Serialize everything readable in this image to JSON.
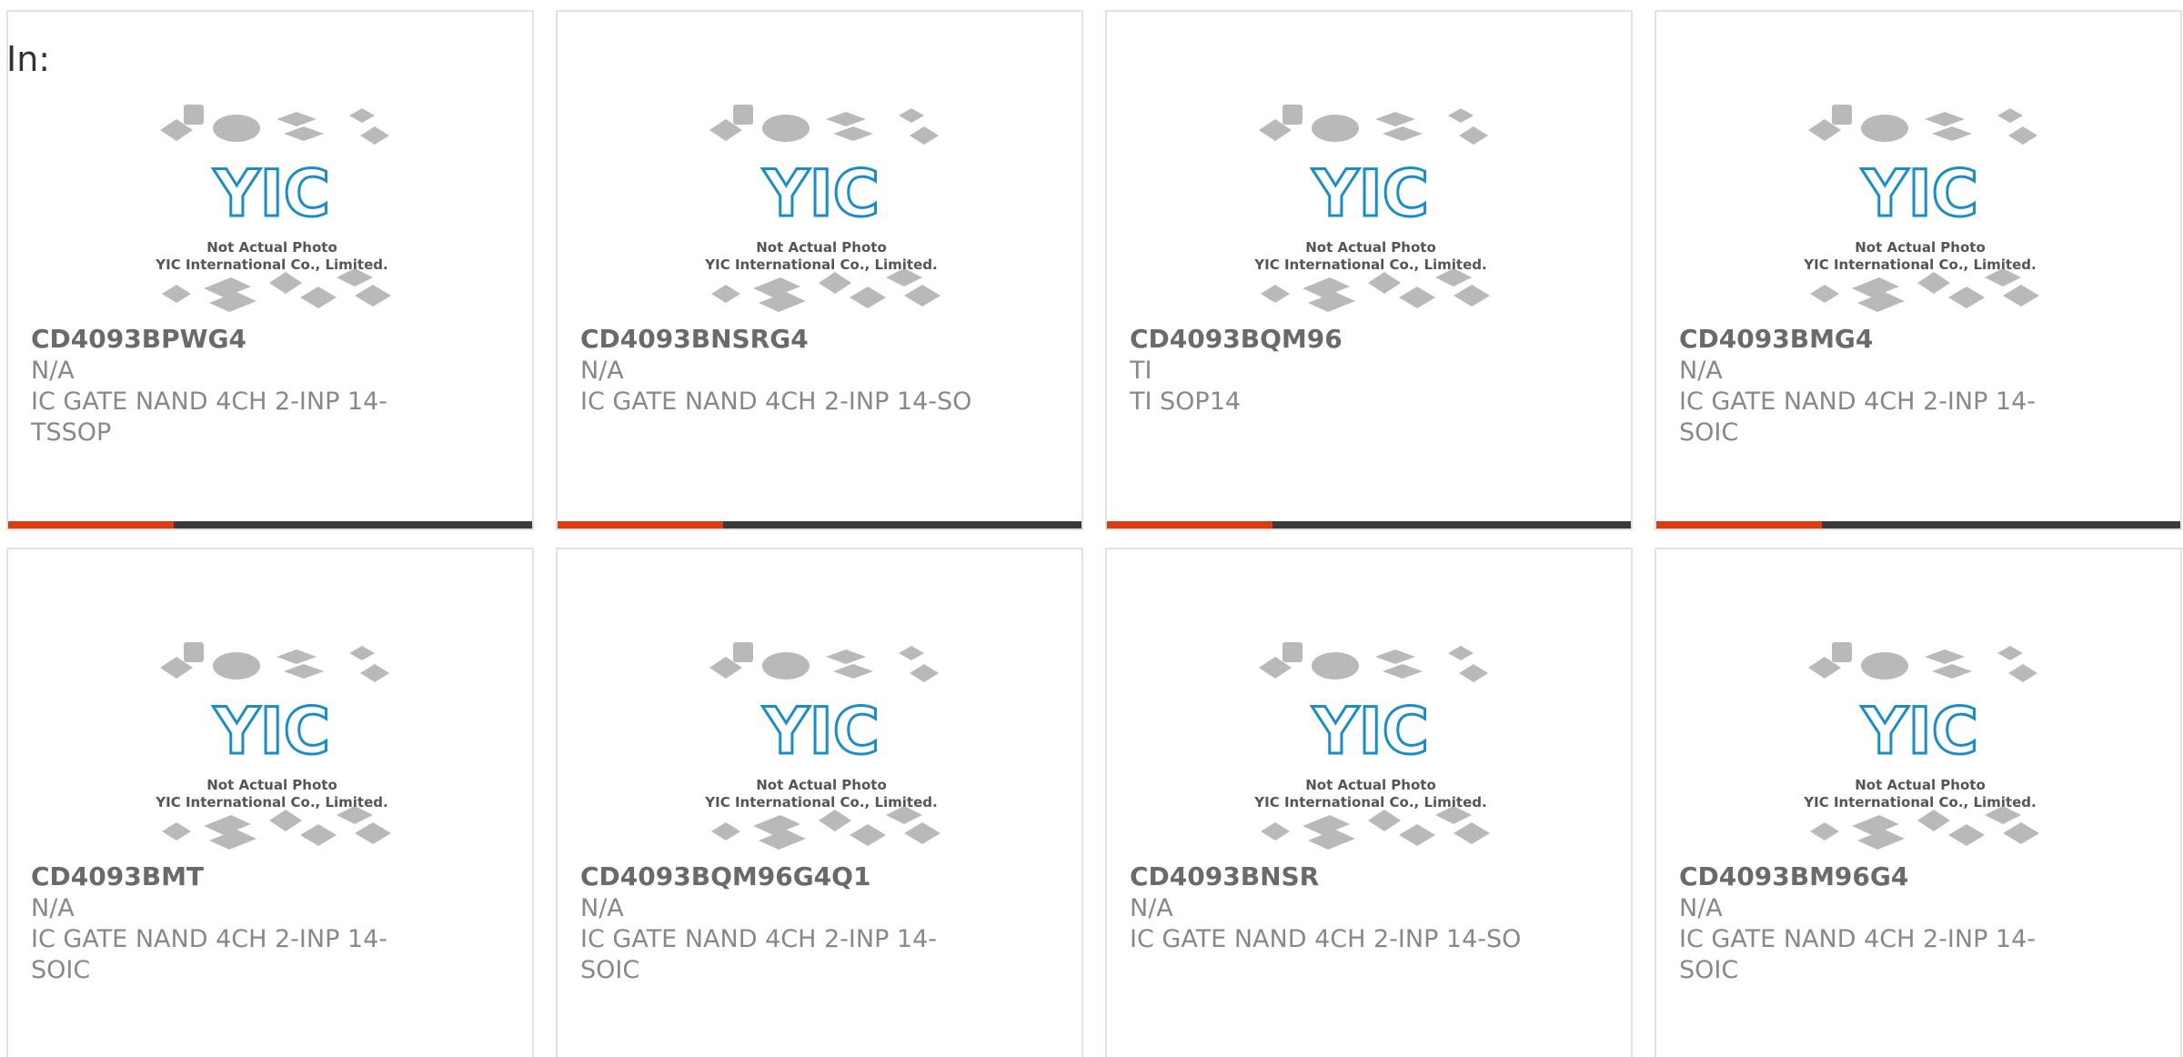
{
  "filter_label": "In:",
  "logo_text": {
    "brand": "YIC",
    "line1": "Not Actual Photo",
    "line2": "YIC International Co., Limited."
  },
  "colors": {
    "accent": "#e03a10",
    "bar_dark": "#3a3a3a",
    "logo_blue": "#1a8cc8",
    "text_muted": "#888888"
  },
  "products": [
    {
      "part_number": "CD4093BPWG4",
      "manufacturer": "N/A",
      "description": "IC GATE NAND 4CH 2-INP 14-TSSOP"
    },
    {
      "part_number": "CD4093BNSRG4",
      "manufacturer": "N/A",
      "description": "IC GATE NAND 4CH 2-INP 14-SO"
    },
    {
      "part_number": "CD4093BQM96",
      "manufacturer": "TI",
      "description": "TI SOP14"
    },
    {
      "part_number": "CD4093BMG4",
      "manufacturer": "N/A",
      "description": "IC GATE NAND 4CH 2-INP 14-SOIC"
    },
    {
      "part_number": "CD4093BMT",
      "manufacturer": "N/A",
      "description": "IC GATE NAND 4CH 2-INP 14-SOIC"
    },
    {
      "part_number": "CD4093BQM96G4Q1",
      "manufacturer": "N/A",
      "description": "IC GATE NAND 4CH 2-INP 14-SOIC"
    },
    {
      "part_number": "CD4093BNSR",
      "manufacturer": "N/A",
      "description": "IC GATE NAND 4CH 2-INP 14-SO"
    },
    {
      "part_number": "CD4093BM96G4",
      "manufacturer": "N/A",
      "description": "IC GATE NAND 4CH 2-INP 14-SOIC"
    }
  ]
}
